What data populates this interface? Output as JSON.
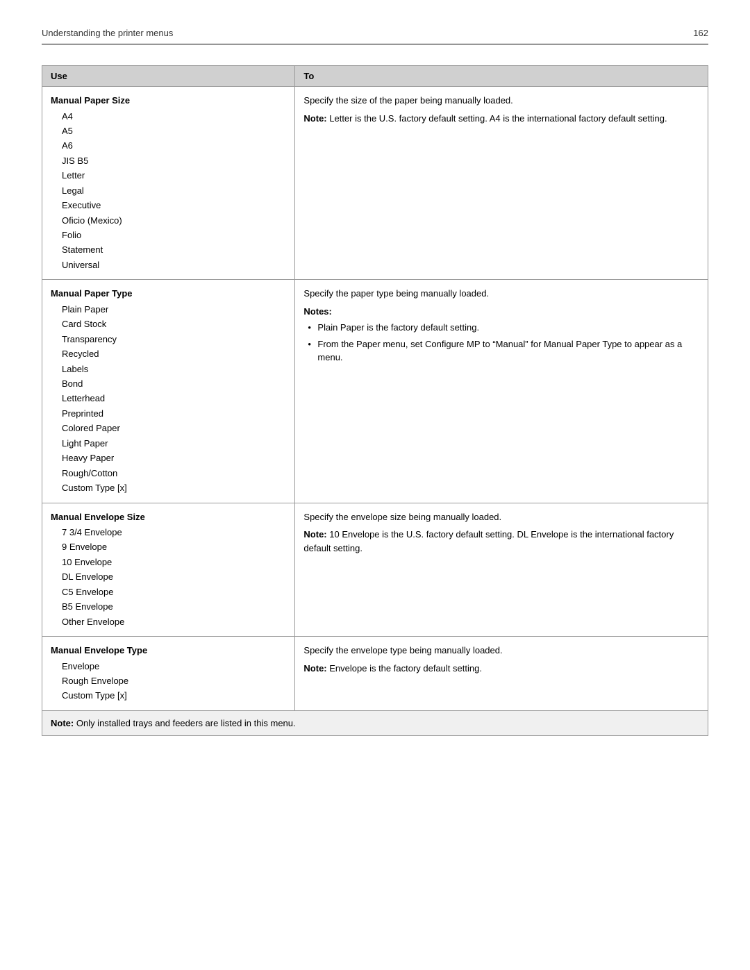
{
  "header": {
    "title": "Understanding the printer menus",
    "page_number": "162"
  },
  "table": {
    "col_use": "Use",
    "col_to": "To",
    "rows": [
      {
        "id": "manual-paper-size",
        "use_header": "Manual Paper Size",
        "use_items": [
          "A4",
          "A5",
          "A6",
          "JIS B5",
          "Letter",
          "Legal",
          "Executive",
          "Oficio (Mexico)",
          "Folio",
          "Statement",
          "Universal"
        ],
        "to_content": {
          "type": "text_with_note",
          "text": "Specify the size of the paper being manually loaded.",
          "note_label": "Note:",
          "note_text": "Letter is the U.S. factory default setting. A4 is the international factory default setting."
        }
      },
      {
        "id": "manual-paper-type",
        "use_header": "Manual Paper Type",
        "use_items": [
          "Plain Paper",
          "Card Stock",
          "Transparency",
          "Recycled",
          "Labels",
          "Bond",
          "Letterhead",
          "Preprinted",
          "Colored Paper",
          "Light Paper",
          "Heavy Paper",
          "Rough/Cotton",
          "Custom Type [x]"
        ],
        "to_content": {
          "type": "text_with_notes_list",
          "text": "Specify the paper type being manually loaded.",
          "notes_label": "Notes:",
          "bullets": [
            "Plain Paper is the factory default setting.",
            "From the Paper menu, set Configure MP to “Manual” for Manual Paper Type to appear as a menu."
          ]
        }
      },
      {
        "id": "manual-envelope-size",
        "use_header": "Manual Envelope Size",
        "use_items": [
          "7 3/4 Envelope",
          "9 Envelope",
          "10 Envelope",
          "DL Envelope",
          "C5 Envelope",
          "B5 Envelope",
          "Other Envelope"
        ],
        "to_content": {
          "type": "text_with_note",
          "text": "Specify the envelope size being manually loaded.",
          "note_label": "Note:",
          "note_text": "10 Envelope is the U.S. factory default setting. DL Envelope is the international factory default setting."
        }
      },
      {
        "id": "manual-envelope-type",
        "use_header": "Manual Envelope Type",
        "use_items": [
          "Envelope",
          "Rough Envelope",
          "Custom Type [x]"
        ],
        "to_content": {
          "type": "text_with_note",
          "text": "Specify the envelope type being manually loaded.",
          "note_label": "Note:",
          "note_text": "Envelope is the factory default setting."
        }
      }
    ],
    "footer": {
      "note_label": "Note:",
      "note_text": "Only installed trays and feeders are listed in this menu."
    }
  }
}
